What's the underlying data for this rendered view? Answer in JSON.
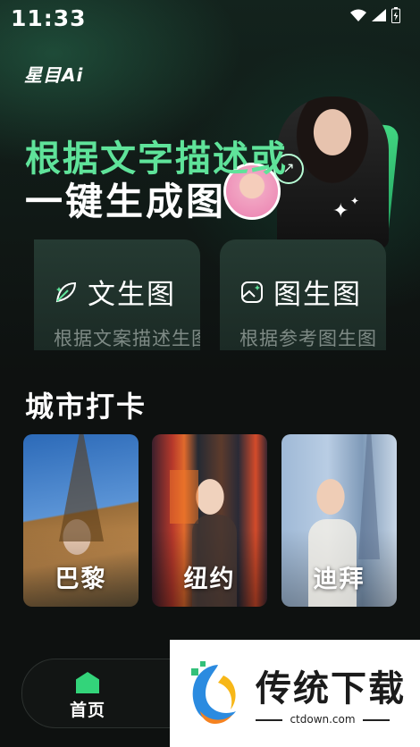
{
  "status_bar": {
    "time": "11:33"
  },
  "logo": "星目Ai",
  "hero": {
    "line1": "根据文字描述或",
    "line2": "一键生成图"
  },
  "features": [
    {
      "title": "文生图",
      "subtitle": "根据文案描述生图",
      "icon": "leaf-icon"
    },
    {
      "title": "图生图",
      "subtitle": "根据参考图生图",
      "icon": "image-icon"
    }
  ],
  "section": {
    "title": "城市打卡"
  },
  "cities": [
    {
      "label": "巴黎"
    },
    {
      "label": "纽约"
    },
    {
      "label": "迪拜"
    }
  ],
  "bottom_nav": {
    "home_label": "首页"
  },
  "watermark": {
    "title": "传统下载",
    "url": "ctdown.com"
  },
  "colors": {
    "accent_green": "#5fe39a",
    "nav_green": "#33d47a",
    "background": "#0e1110"
  }
}
